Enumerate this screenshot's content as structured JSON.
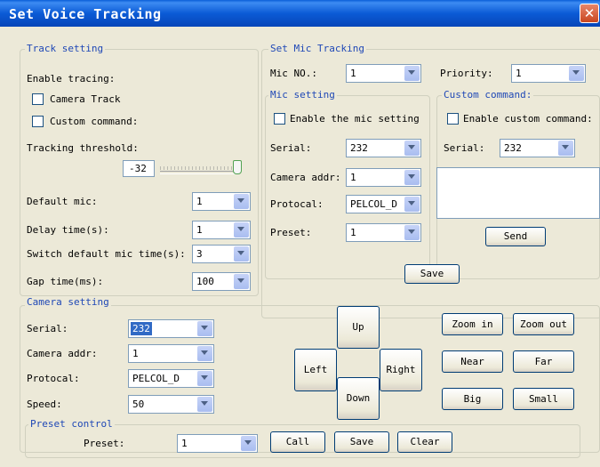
{
  "window": {
    "title": "Set Voice Tracking"
  },
  "track_setting": {
    "legend": "Track setting",
    "enable_tracing_label": "Enable tracing:",
    "camera_track_label": "Camera Track",
    "custom_command_label": "Custom command:",
    "tracking_threshold_label": "Tracking threshold:",
    "threshold_value": "-32",
    "default_mic_label": "Default mic:",
    "default_mic_value": "1",
    "delay_time_label": "Delay time(s):",
    "delay_time_value": "1",
    "switch_default_label": "Switch default mic time(s):",
    "switch_default_value": "3",
    "gap_time_label": "Gap time(ms):",
    "gap_time_value": "100"
  },
  "mic_tracking": {
    "legend": "Set Mic Tracking",
    "mic_no_label": "Mic NO.:",
    "mic_no_value": "1",
    "priority_label": "Priority:",
    "priority_value": "1",
    "save_label": "Save"
  },
  "mic_setting": {
    "legend": "Mic setting",
    "enable_label": "Enable the mic setting",
    "serial_label": "Serial:",
    "serial_value": "232",
    "camera_addr_label": "Camera addr:",
    "camera_addr_value": "1",
    "protocol_label": "Protocal:",
    "protocol_value": "PELCOL_D",
    "preset_label": "Preset:",
    "preset_value": "1"
  },
  "custom_command": {
    "legend": "Custom command:",
    "enable_label": "Enable custom command:",
    "serial_label": "Serial:",
    "serial_value": "232",
    "send_label": "Send"
  },
  "camera_setting": {
    "legend": "Camera setting",
    "serial_label": "Serial:",
    "serial_value": "232",
    "camera_addr_label": "Camera addr:",
    "camera_addr_value": "1",
    "protocol_label": "Protocal:",
    "protocol_value": "PELCOL_D",
    "speed_label": "Speed:",
    "speed_value": "50",
    "up_label": "Up",
    "left_label": "Left",
    "right_label": "Right",
    "down_label": "Down",
    "zoom_in_label": "Zoom in",
    "zoom_out_label": "Zoom out",
    "near_label": "Near",
    "far_label": "Far",
    "big_label": "Big",
    "small_label": "Small"
  },
  "preset_control": {
    "legend": "Preset control",
    "preset_label": "Preset:",
    "preset_value": "1",
    "call_label": "Call",
    "save_label": "Save",
    "clear_label": "Clear"
  }
}
